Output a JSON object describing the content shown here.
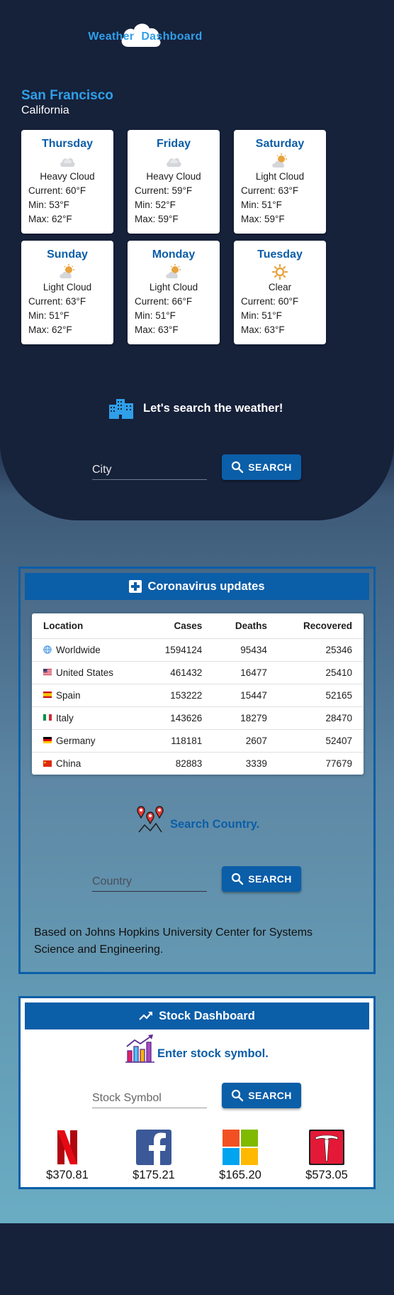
{
  "app": {
    "title_word1": "Weather",
    "title_word2": "Dashboard"
  },
  "weather": {
    "city": "San Francisco",
    "state": "California",
    "days": [
      {
        "day": "Thursday",
        "condition": "Heavy Cloud",
        "icon": "heavy-cloud-icon",
        "current": "Current: 60°F",
        "min": "Min: 53°F",
        "max": "Max: 62°F"
      },
      {
        "day": "Friday",
        "condition": "Heavy Cloud",
        "icon": "heavy-cloud-icon",
        "current": "Current: 59°F",
        "min": "Min: 52°F",
        "max": "Max: 59°F"
      },
      {
        "day": "Saturday",
        "condition": "Light Cloud",
        "icon": "light-cloud-icon",
        "current": "Current: 63°F",
        "min": "Min: 51°F",
        "max": "Max: 59°F"
      },
      {
        "day": "Sunday",
        "condition": "Light Cloud",
        "icon": "light-cloud-icon",
        "current": "Current: 63°F",
        "min": "Min: 51°F",
        "max": "Max: 62°F"
      },
      {
        "day": "Monday",
        "condition": "Light Cloud",
        "icon": "light-cloud-icon",
        "current": "Current: 66°F",
        "min": "Min: 51°F",
        "max": "Max: 63°F"
      },
      {
        "day": "Tuesday",
        "condition": "Clear",
        "icon": "sun-icon",
        "current": "Current: 60°F",
        "min": "Min: 51°F",
        "max": "Max: 63°F"
      }
    ],
    "search_prompt": "Let's search the weather!",
    "city_input": {
      "placeholder": "City",
      "value": ""
    },
    "search_label": "SEARCH"
  },
  "covid": {
    "title": "Coronavirus updates",
    "headers": {
      "location": "Location",
      "cases": "Cases",
      "deaths": "Deaths",
      "recovered": "Recovered"
    },
    "rows": [
      {
        "location": "Worldwide",
        "cases": "1594124",
        "deaths": "95434",
        "recovered": "25346",
        "flag": "globe-icon"
      },
      {
        "location": "United States",
        "cases": "461432",
        "deaths": "16477",
        "recovered": "25410",
        "flag": "us-flag-icon"
      },
      {
        "location": "Spain",
        "cases": "153222",
        "deaths": "15447",
        "recovered": "52165",
        "flag": "spain-flag-icon"
      },
      {
        "location": "Italy",
        "cases": "143626",
        "deaths": "18279",
        "recovered": "28470",
        "flag": "italy-flag-icon"
      },
      {
        "location": "Germany",
        "cases": "118181",
        "deaths": "2607",
        "recovered": "52407",
        "flag": "germany-flag-icon"
      },
      {
        "location": "China",
        "cases": "82883",
        "deaths": "3339",
        "recovered": "77679",
        "flag": "china-flag-icon"
      }
    ],
    "search_prompt": "Search Country.",
    "country_input": {
      "placeholder": "Country",
      "value": ""
    },
    "search_label": "SEARCH",
    "source_note": "Based on Johns Hopkins University Center for Systems Science and Engineering."
  },
  "stocks": {
    "title": "Stock Dashboard",
    "search_prompt": "Enter stock symbol.",
    "symbol_input": {
      "placeholder": "Stock Symbol",
      "value": ""
    },
    "search_label": "SEARCH",
    "items": [
      {
        "logo": "netflix-logo-icon",
        "price": "$370.81"
      },
      {
        "logo": "facebook-logo-icon",
        "price": "$175.21"
      },
      {
        "logo": "microsoft-logo-icon",
        "price": "$165.20"
      },
      {
        "logo": "tesla-logo-icon",
        "price": "$573.05"
      }
    ]
  },
  "colors": {
    "navy_background": "#16213a",
    "accent_blue": "#0b5ea8",
    "title_blue": "#2f9fe8",
    "teal_gradient_end": "#6aadc3"
  }
}
